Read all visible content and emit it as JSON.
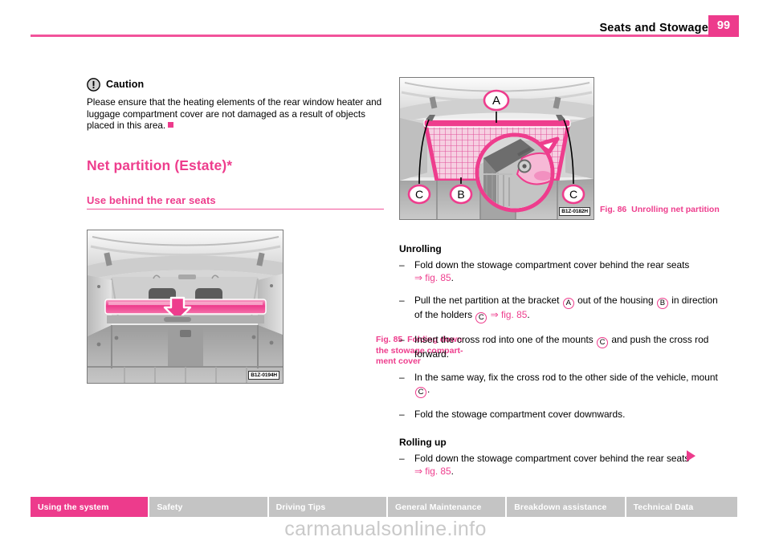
{
  "header": {
    "title": "Seats and Stowage",
    "page_number": "99",
    "accent_color": "#ed3b8c"
  },
  "caution": {
    "icon": "warning-exclamation-icon",
    "label": "Caution",
    "body": "Please ensure that the heating elements of the rear window heater and luggage compartment cover are not damaged as a result of objects placed in this area."
  },
  "section": {
    "title": "Net partition (Estate)*",
    "subtitle": "Use behind the rear seats"
  },
  "figures": {
    "fig85": {
      "caption_number": "Fig. 85",
      "caption_text": "Folding down the stowage compart-ment cover",
      "code": "B1Z-0194H"
    },
    "fig86": {
      "caption_number": "Fig. 86",
      "caption_text": "Unrolling net partition",
      "code": "B1Z-0182H",
      "callouts": [
        "A",
        "B",
        "C",
        "C"
      ]
    }
  },
  "procedures": [
    {
      "heading": "Unrolling",
      "steps": [
        {
          "parts": [
            {
              "t": "text",
              "v": "Fold down the stowage compartment cover behind the rear seats "
            },
            {
              "t": "ref",
              "v": "⇒ fig. 85"
            },
            {
              "t": "text",
              "v": "."
            }
          ]
        },
        {
          "parts": [
            {
              "t": "text",
              "v": "Pull the net partition at the bracket "
            },
            {
              "t": "cap",
              "v": "A"
            },
            {
              "t": "text",
              "v": " out of the housing "
            },
            {
              "t": "cap",
              "v": "B"
            },
            {
              "t": "text",
              "v": " in direction of the holders "
            },
            {
              "t": "cap",
              "v": "C"
            },
            {
              "t": "text",
              "v": " "
            },
            {
              "t": "ref",
              "v": "⇒ fig. 85"
            },
            {
              "t": "text",
              "v": "."
            }
          ]
        },
        {
          "parts": [
            {
              "t": "text",
              "v": "Insert the cross rod into one of the mounts "
            },
            {
              "t": "cap",
              "v": "C"
            },
            {
              "t": "text",
              "v": " and push the cross rod forward."
            }
          ]
        },
        {
          "parts": [
            {
              "t": "text",
              "v": "In the same way, fix the cross rod to the other side of the vehicle, mount "
            },
            {
              "t": "cap",
              "v": "C"
            },
            {
              "t": "text",
              "v": "."
            }
          ]
        },
        {
          "parts": [
            {
              "t": "text",
              "v": "Fold the stowage compartment cover downwards."
            }
          ]
        }
      ]
    },
    {
      "heading": "Rolling up",
      "steps": [
        {
          "parts": [
            {
              "t": "text",
              "v": "Fold down the stowage compartment cover behind the rear seats "
            },
            {
              "t": "ref",
              "v": "⇒ fig. 85"
            },
            {
              "t": "text",
              "v": "."
            }
          ]
        }
      ]
    }
  ],
  "dash": "–",
  "footer": {
    "tabs": [
      {
        "label": "Using the system",
        "active": true,
        "width": 148
      },
      {
        "label": "Safety",
        "active": false,
        "width": 148
      },
      {
        "label": "Driving Tips",
        "active": false,
        "width": 148
      },
      {
        "label": "General Maintenance",
        "active": false,
        "width": 148
      },
      {
        "label": "Breakdown assistance",
        "active": false,
        "width": 148
      },
      {
        "label": "Technical Data",
        "active": false,
        "width": 140
      }
    ]
  },
  "watermark": "carmanualsonline.info"
}
